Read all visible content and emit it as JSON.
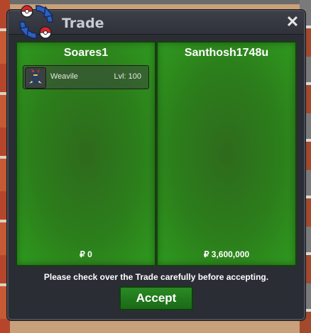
{
  "window": {
    "title": "Trade",
    "close_glyph": "✕"
  },
  "trade": {
    "left_player": {
      "name": "Soares1",
      "items": [
        {
          "name": "Weavile",
          "level": "Lvl: 100",
          "icon": "weavile-sprite-icon"
        }
      ],
      "money": "₽ 0"
    },
    "right_player": {
      "name": "Santhosh1748u",
      "items": [],
      "money": "₽ 3,600,000"
    },
    "notice": "Please check over the Trade carefully before accepting.",
    "accept_label": "Accept"
  },
  "colors": {
    "panel_green": "#2c7e1b",
    "window_bg": "#2b2d35",
    "accept_green": "#2a8a24"
  }
}
